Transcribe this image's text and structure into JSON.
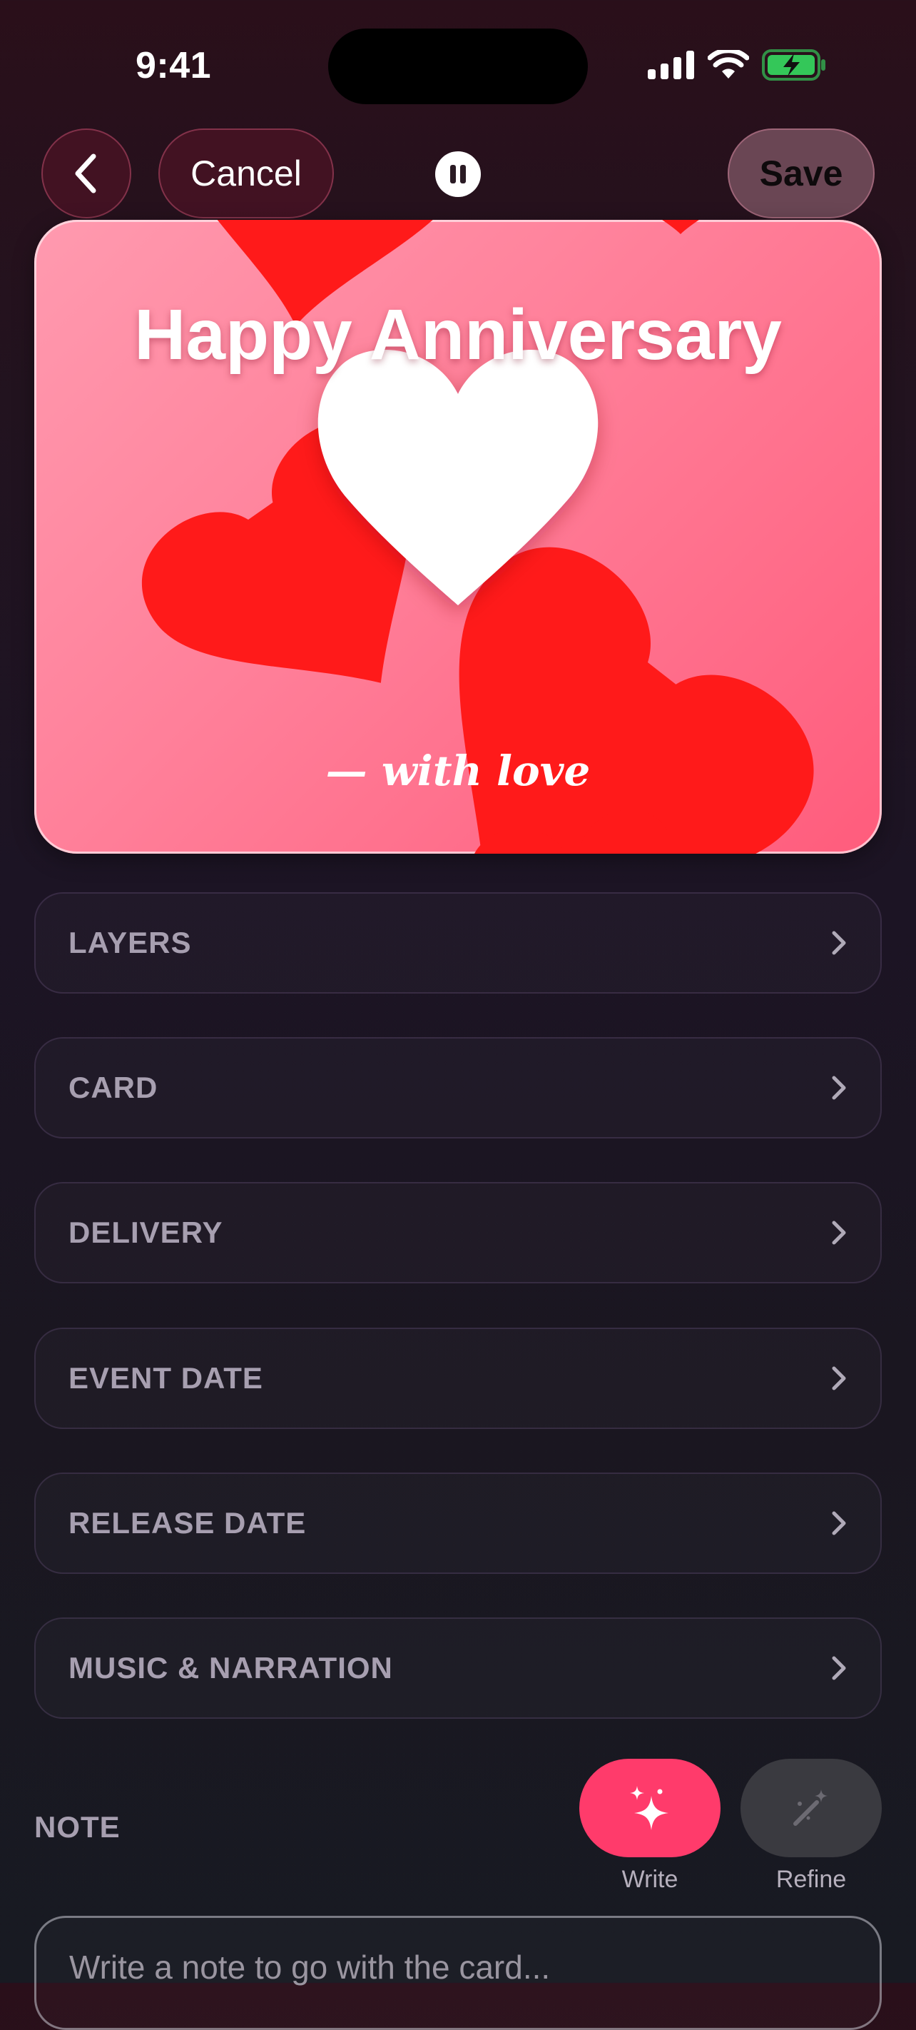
{
  "status_bar": {
    "time": "9:41"
  },
  "nav": {
    "cancel_label": "Cancel",
    "save_label": "Save"
  },
  "card_preview": {
    "title": "Happy Anniversary",
    "signature": "— with love"
  },
  "settings_rows": [
    {
      "label": "LAYERS"
    },
    {
      "label": "CARD"
    },
    {
      "label": "DELIVERY"
    },
    {
      "label": "EVENT DATE"
    },
    {
      "label": "RELEASE DATE"
    },
    {
      "label": "MUSIC & NARRATION"
    }
  ],
  "note": {
    "section_label": "NOTE",
    "write_label": "Write",
    "refine_label": "Refine",
    "placeholder": "Write a note to go with the card..."
  },
  "colors": {
    "accent": "#ff3b6b",
    "battery": "#34c759",
    "card_heart": "#ff1a1a",
    "card_background": "#ff7f99"
  },
  "icons": {
    "back": "chevron-left-icon",
    "pause": "pause-icon",
    "row_chevron": "chevron-right-icon",
    "write": "sparkles-icon",
    "refine": "magic-wand-icon"
  }
}
